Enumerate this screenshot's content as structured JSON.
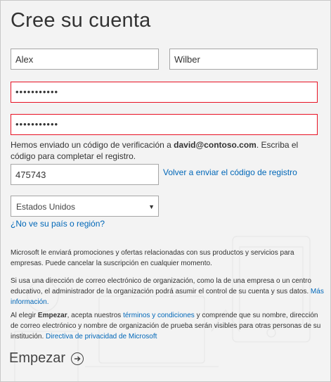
{
  "form": {
    "title": "Cree su cuenta",
    "first_name": "Alex",
    "last_name": "Wilber",
    "password": "•••••••••••",
    "password_confirm": "•••••••••••",
    "verification_prefix": "Hemos enviado un código de verificación a ",
    "email": "david@contoso.com",
    "verification_suffix": ". Escriba el código para completar el registro.",
    "code": "475743",
    "resend_link": "Volver a enviar el código de registro",
    "country": "Estados Unidos",
    "country_link": "¿No ve su país o región?"
  },
  "legal": {
    "promo": "Microsoft le enviará promociones y ofertas relacionadas con sus productos y servicios para empresas. Puede cancelar la suscripción en cualquier momento.",
    "org_notice": "Si usa una dirección de correo electrónico de organización, como la de una empresa o un centro educativo, el administrador de la organización podrá asumir el control de su cuenta y sus datos.",
    "more_info": "Más información.",
    "terms_prefix": "Al elegir ",
    "terms_bold": "Empezar",
    "terms_mid": ", acepta nuestros ",
    "terms_link": "términos y condiciones",
    "terms_suffix": " y comprende que su nombre, dirección de correo electrónico y nombre de organización de prueba serán visibles para otras personas de su institución.",
    "privacy_link": "Directiva de privacidad de Microsoft"
  },
  "submit": {
    "label": "Empezar",
    "icon": "arrow-right-circle-icon"
  },
  "colors": {
    "link": "#0067b8",
    "error_border": "#e81123",
    "background": "#f3f3f3"
  }
}
